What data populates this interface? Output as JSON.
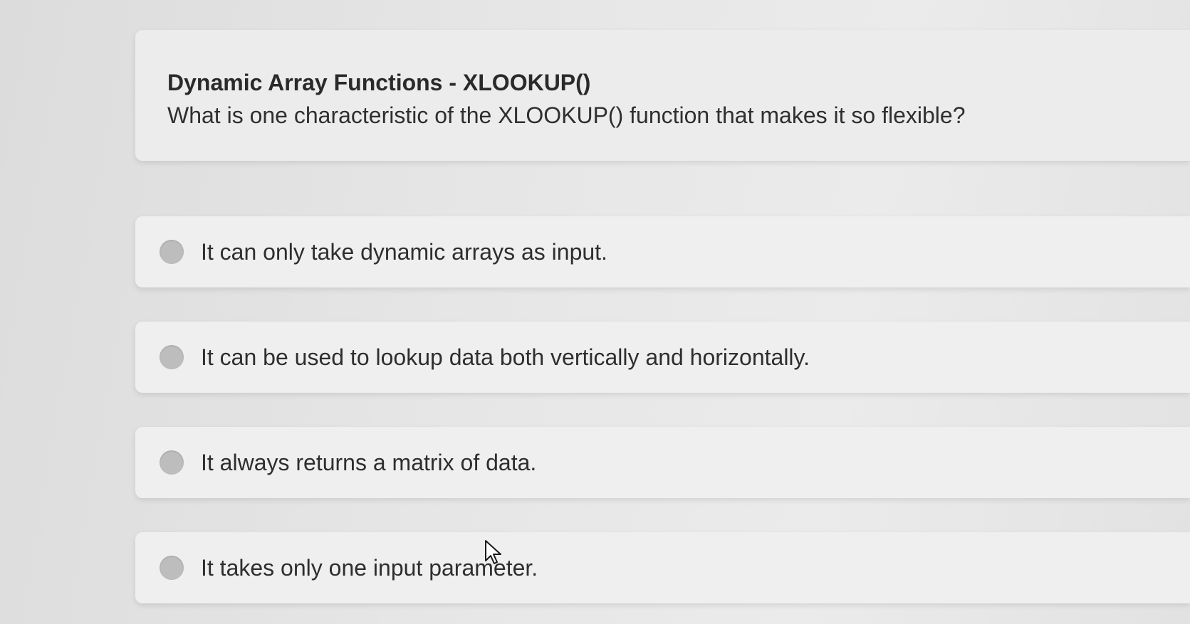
{
  "question": {
    "title": "Dynamic Array Functions - XLOOKUP()",
    "text": "What is one characteristic of the XLOOKUP() function that makes it so flexible?"
  },
  "options": [
    {
      "label": "It can only take dynamic arrays as input."
    },
    {
      "label": "It can be used to lookup data both vertically and horizontally."
    },
    {
      "label": "It always returns a matrix of data."
    },
    {
      "label": "It takes only one input parameter."
    }
  ],
  "icons": {
    "cursor": "mouse-pointer-icon",
    "radio": "radio-button-icon"
  }
}
